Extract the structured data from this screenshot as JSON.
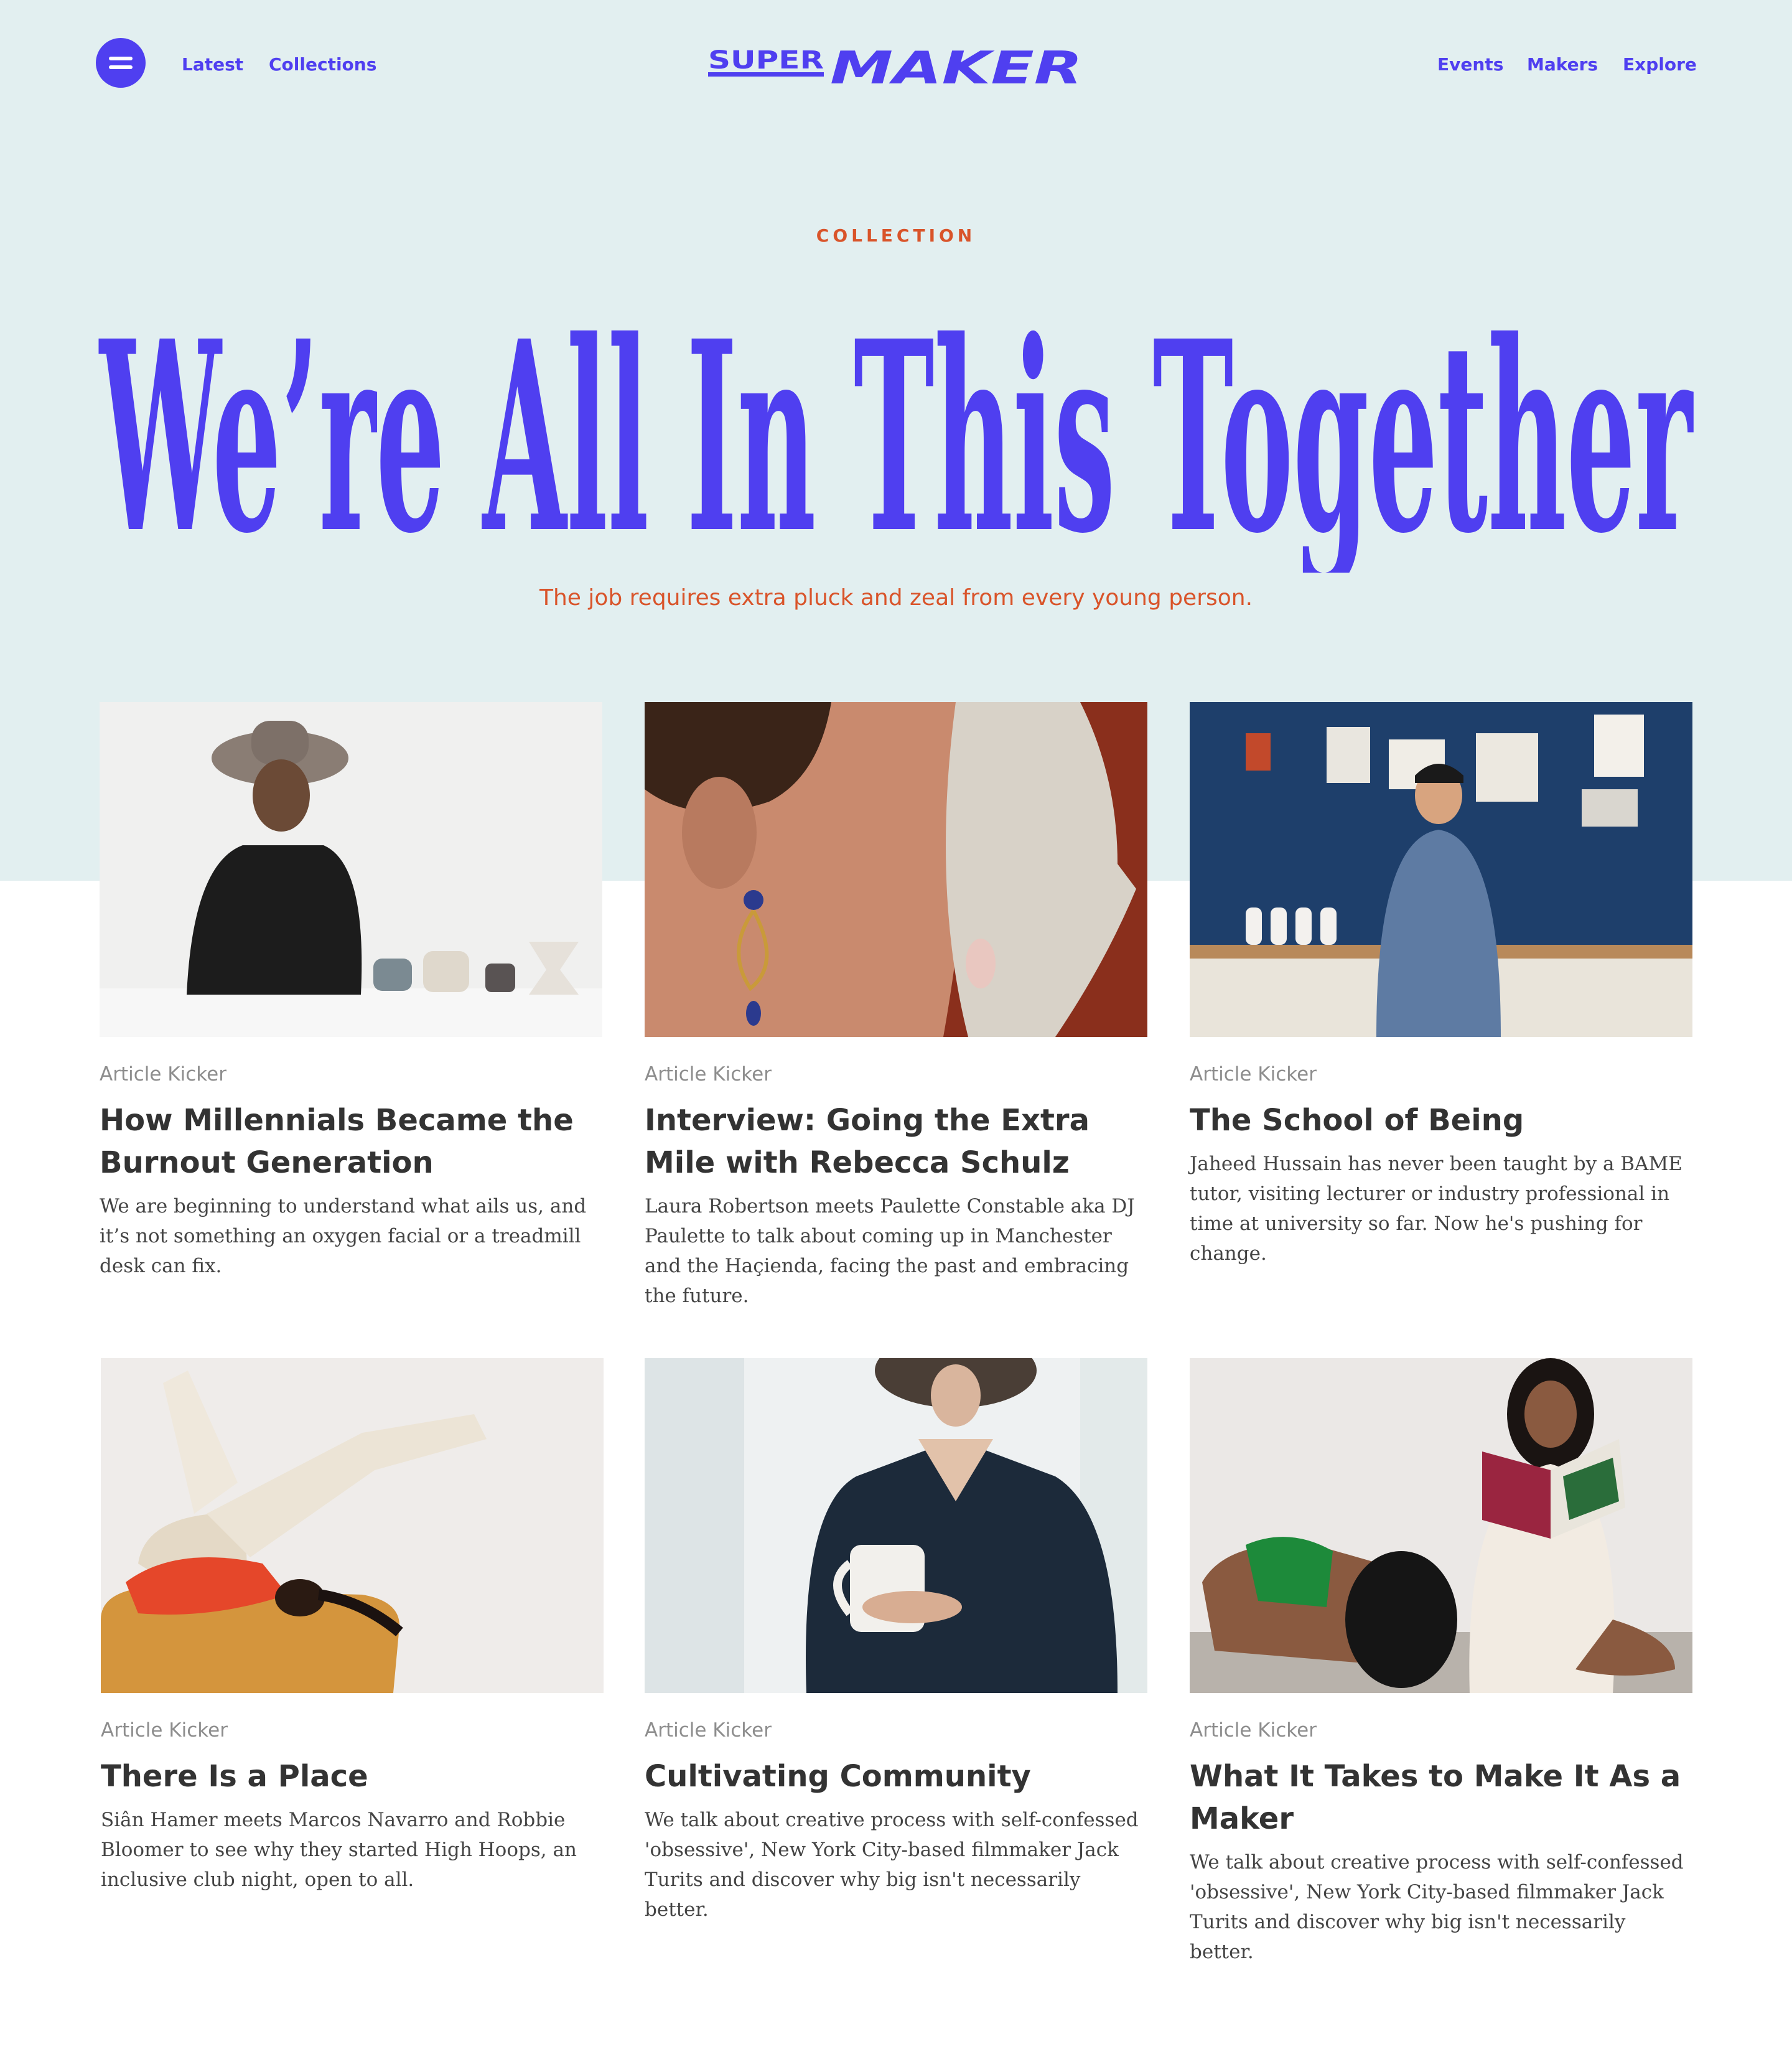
{
  "header": {
    "logo_text": "SUPERMAKER",
    "nav_left": [
      {
        "label": "Latest"
      },
      {
        "label": "Collections"
      }
    ],
    "nav_right": [
      {
        "label": "Events"
      },
      {
        "label": "Makers"
      },
      {
        "label": "Explore"
      }
    ],
    "menu_icon": "hamburger-icon"
  },
  "hero": {
    "kicker": "COLLECTION",
    "title": "We’re All In This Together",
    "subtitle": "The job requires extra pluck and zeal from every young person."
  },
  "colors": {
    "accent": "#4f3ff0",
    "kicker": "#d9542a",
    "hero_background": "#e2eff0",
    "text": "#333333",
    "muted": "#8d8d8d"
  },
  "articles": [
    {
      "kicker": "Article Kicker",
      "title": "How Millennials Became the Burnout Generation",
      "description": "We are beginning to understand what ails us, and it’s not something an oxygen facial or a treadmill desk can fix.",
      "image": "photo-woman-in-hat-with-ceramics"
    },
    {
      "kicker": "Article Kicker",
      "title": "Interview: Going the Extra Mile with Rebecca Schulz",
      "description": "Laura Robertson meets Paulette Constable aka DJ Paulette to talk about coming up in Manchester and the Haçienda, facing the past and embracing the future.",
      "image": "photo-woman-with-mask-and-earring"
    },
    {
      "kicker": "Article Kicker",
      "title": "The School of Being",
      "description": "Jaheed Hussain has never been taught by a BAME tutor, visiting lecturer or industry professional in time at university so far. Now he's pushing for change.",
      "image": "photo-man-in-studio"
    },
    {
      "kicker": "Article Kicker",
      "title": "There Is a Place",
      "description": "Siân Hamer meets Marcos Navarro and Robbie Bloomer to see why they started High Hoops, an inclusive club night, open to all.",
      "image": "photo-woman-legs-up-on-sofa"
    },
    {
      "kicker": "Article Kicker",
      "title": "Cultivating Community",
      "description": "We talk about creative process with self-confessed 'obsessive', New York City-based filmmaker Jack Turits and discover why big isn't necessarily better.",
      "image": "photo-woman-holding-mug"
    },
    {
      "kicker": "Article Kicker",
      "title": "What It Takes to Make It As a Maker",
      "description": "We talk about creative process with self-confessed 'obsessive', New York City-based filmmaker Jack Turits and discover why big isn't necessarily better.",
      "image": "photo-two-women-reading-magazine"
    }
  ]
}
